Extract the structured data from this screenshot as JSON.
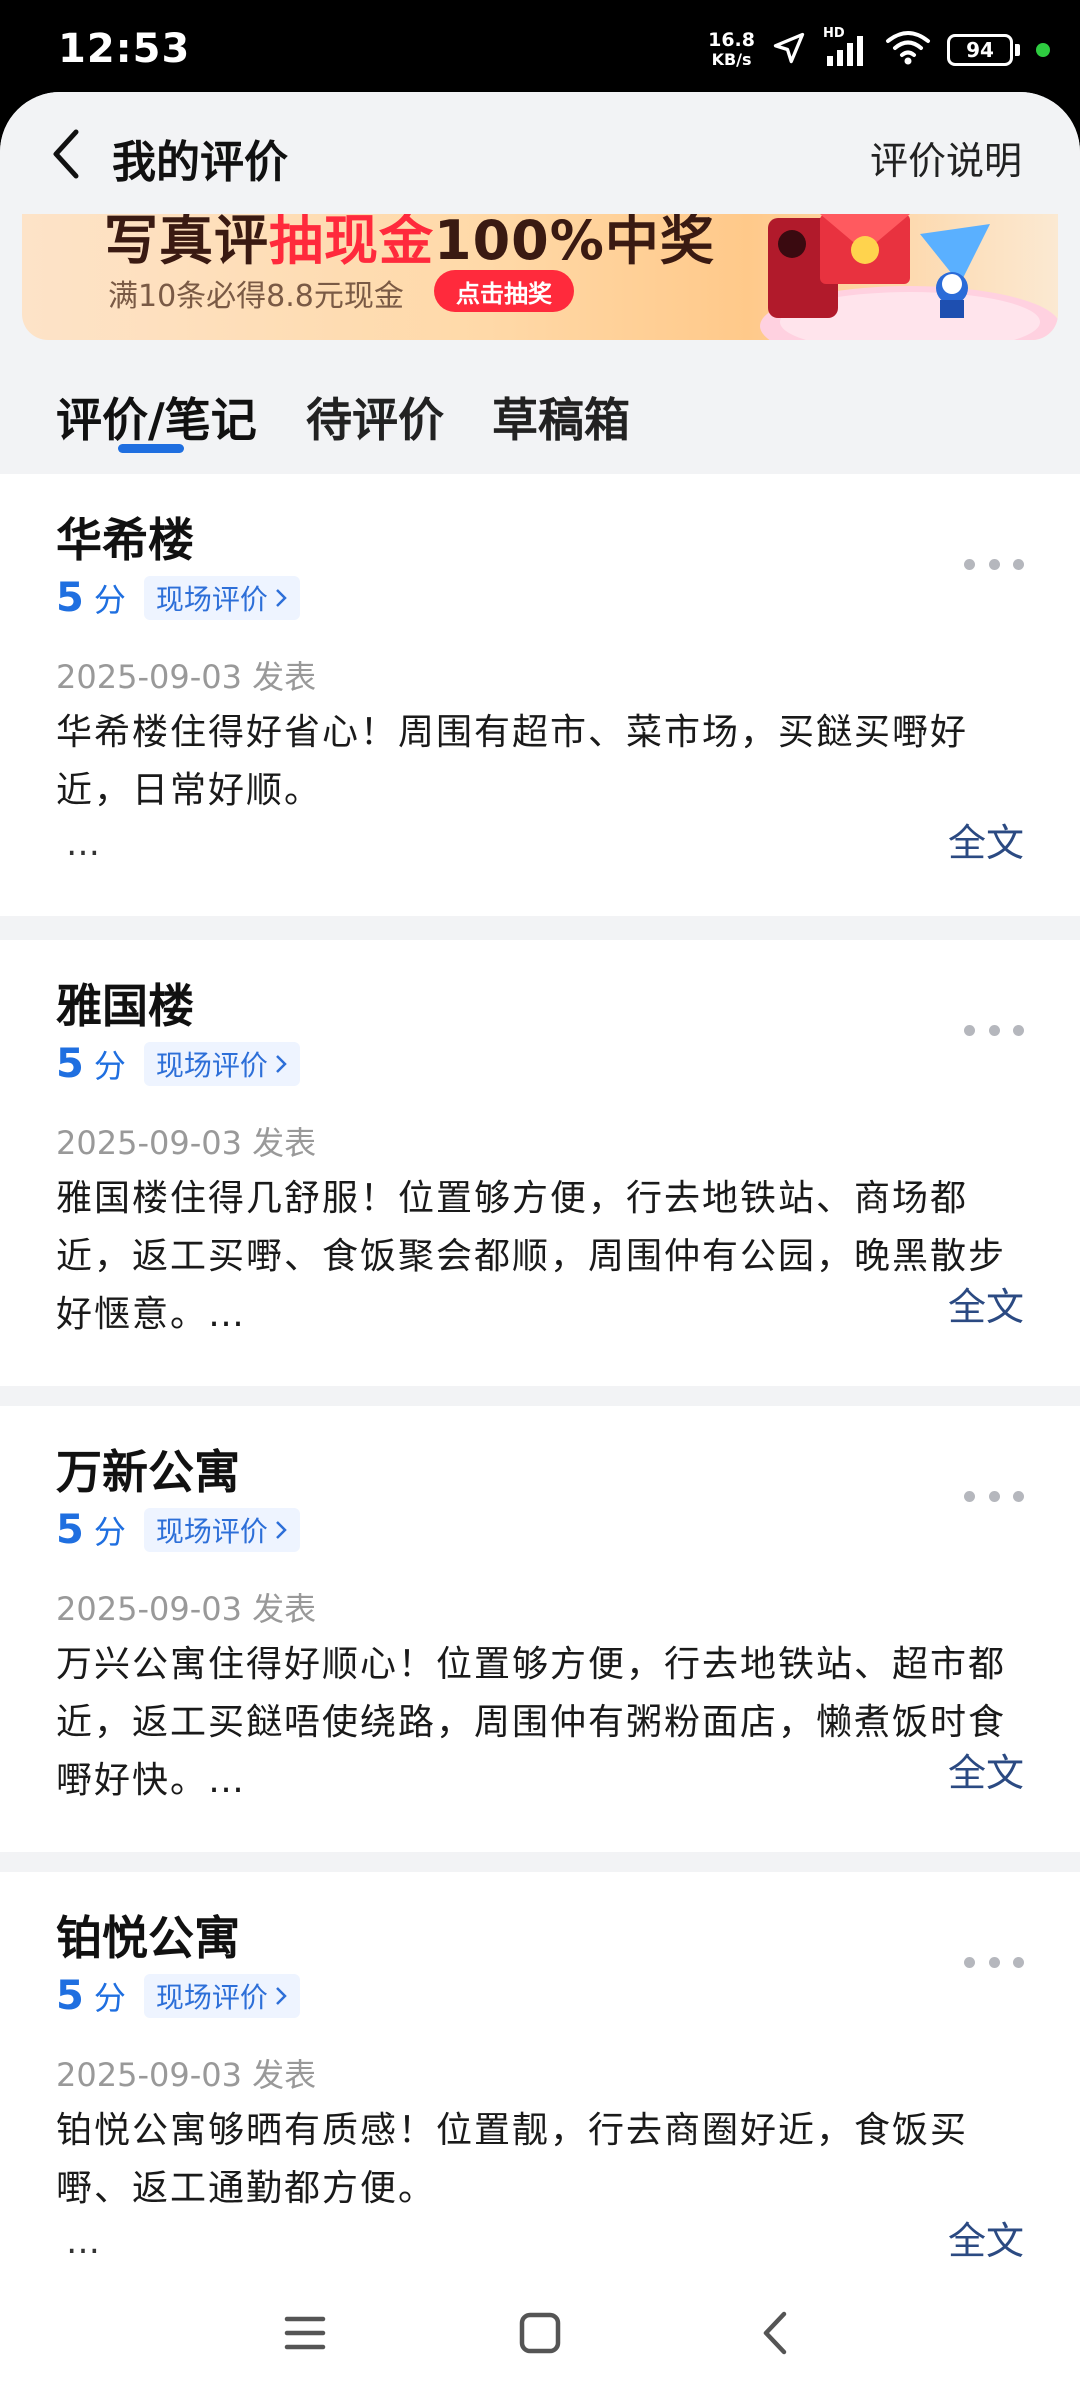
{
  "status_bar": {
    "time": "12:53",
    "net_speed_value": "16.8",
    "net_speed_unit": "KB/s",
    "signal_label": "HD",
    "battery": "94"
  },
  "header": {
    "title": "我的评价",
    "right_link": "评价说明"
  },
  "banner": {
    "headline_prefix": "写真评",
    "headline_highlight": "抽现金",
    "headline_suffix": "100%中奖",
    "subtitle": "满10条必得8.8元现金",
    "button": "点击抽奖"
  },
  "tabs": [
    {
      "label": "评价/笔记",
      "active": true
    },
    {
      "label": "待评价",
      "active": false
    },
    {
      "label": "草稿箱",
      "active": false
    }
  ],
  "reviews": [
    {
      "title": "华希楼",
      "score": "5",
      "score_unit": "分",
      "tag": "现场评价",
      "date": "2025-09-03 发表",
      "body": "华希楼住得好省心！周围有超市、菜市场，买餸买嘢好近，日常好顺。",
      "ellipsis": "…",
      "full_text": "全文"
    },
    {
      "title": "雅国楼",
      "score": "5",
      "score_unit": "分",
      "tag": "现场评价",
      "date": "2025-09-03 发表",
      "body": "雅国楼住得几舒服！位置够方便，行去地铁站、商场都近，返工买嘢、食饭聚会都顺，周围仲有公园，晚黑散步好惬意。…",
      "full_text": "全文"
    },
    {
      "title": "万新公寓",
      "score": "5",
      "score_unit": "分",
      "tag": "现场评价",
      "date": "2025-09-03 发表",
      "body": "万兴公寓住得好顺心！位置够方便，行去地铁站、超市都近，返工买餸唔使绕路，周围仲有粥粉面店，懒煮饭时食嘢好快。…",
      "full_text": "全文"
    },
    {
      "title": "铂悦公寓",
      "score": "5",
      "score_unit": "分",
      "tag": "现场评价",
      "date": "2025-09-03 发表",
      "body": "铂悦公寓够晒有质感！位置靓，行去商圈好近，食饭买嘢、返工通勤都方便。",
      "ellipsis": "…",
      "full_text": "全文"
    }
  ],
  "colors": {
    "accent_blue": "#1f6fe0",
    "link_dark_blue": "#2b4a82",
    "banner_red": "#ff2a3c"
  }
}
